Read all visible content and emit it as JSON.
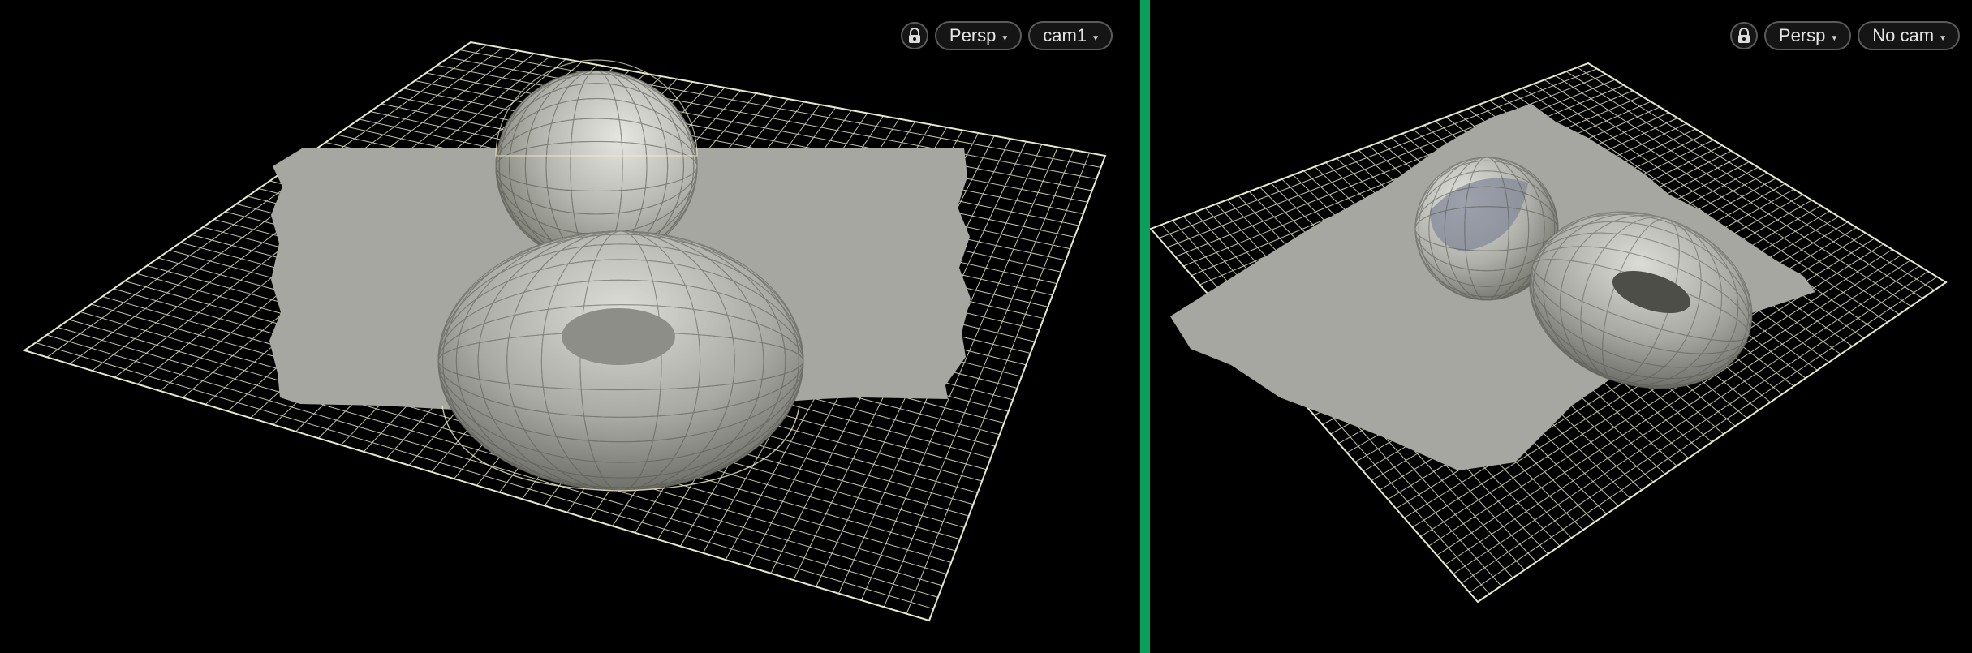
{
  "viewports": {
    "left": {
      "lock_icon": "lock-icon",
      "projection_label": "Persp",
      "camera_label": "cam1"
    },
    "right": {
      "lock_icon": "lock-icon",
      "projection_label": "Persp",
      "camera_label": "No cam"
    }
  },
  "dropdown_icon": "caret-down-icon",
  "colors": {
    "background": "#000000",
    "divider": "#08a05a",
    "grid_wire": "#e8e8c8",
    "shaded_surface": "#a6a7a0",
    "wireframe_highlight": "#f2efc6"
  }
}
